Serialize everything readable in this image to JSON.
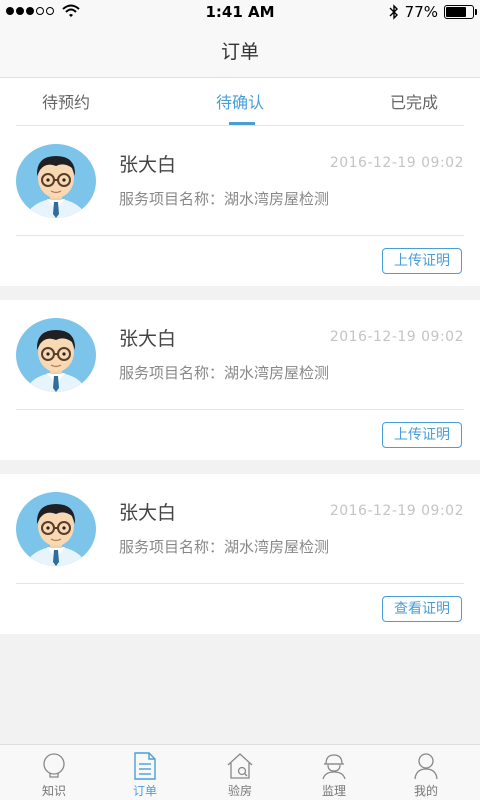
{
  "status_bar": {
    "time": "1:41 AM",
    "battery_text": "77%",
    "battery_level": 0.77,
    "icons": [
      "signal-dots-icon",
      "wifi-icon",
      "bluetooth-icon",
      "battery-icon"
    ]
  },
  "header": {
    "title": "订单"
  },
  "tabs": [
    {
      "label": "待预约",
      "active": false
    },
    {
      "label": "待确认",
      "active": true
    },
    {
      "label": "已完成",
      "active": false
    }
  ],
  "orders": [
    {
      "name": "张大白",
      "datetime": "2016-12-19   09:02",
      "project": "服务项目名称：湖水湾房屋检测",
      "action_label": "上传证明"
    },
    {
      "name": "张大白",
      "datetime": "2016-12-19   09:02",
      "project": "服务项目名称：湖水湾房屋检测",
      "action_label": "上传证明"
    },
    {
      "name": "张大白",
      "datetime": "2016-12-19   09:02",
      "project": "服务项目名称：湖水湾房屋检测",
      "action_label": "查看证明"
    }
  ],
  "tabbar": [
    {
      "label": "知识",
      "icon": "lightbulb-icon",
      "active": false
    },
    {
      "label": "订单",
      "icon": "document-icon",
      "active": true
    },
    {
      "label": "验房",
      "icon": "house-search-icon",
      "active": false
    },
    {
      "label": "监理",
      "icon": "hardhat-worker-icon",
      "active": false
    },
    {
      "label": "我的",
      "icon": "person-icon",
      "active": false
    }
  ],
  "colors": {
    "accent": "#4a9ed8",
    "background": "#f2f2f2",
    "avatar_bg": "#7cc4ea"
  }
}
